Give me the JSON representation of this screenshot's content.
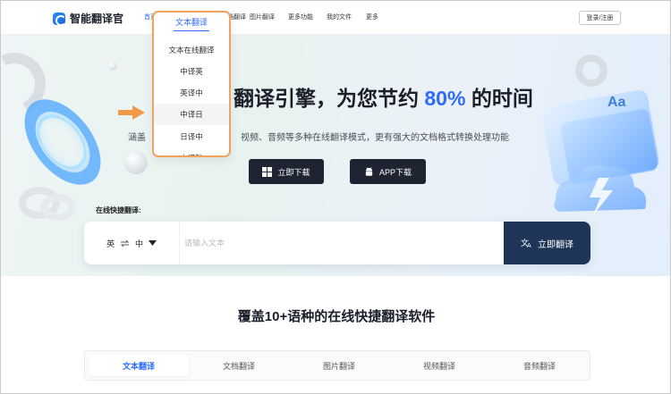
{
  "app": {
    "name": "智能翻译官"
  },
  "nav": {
    "items": [
      {
        "label": "首页",
        "active": true
      },
      {
        "label": "文档翻译",
        "active": false
      },
      {
        "label": "图片翻译",
        "active": false
      },
      {
        "label": "更多功能",
        "active": false
      },
      {
        "label": "我的文件",
        "active": false
      },
      {
        "label": "更多",
        "active": false
      }
    ],
    "login_label": "登录/注册"
  },
  "dropdown": {
    "header": "文本翻译",
    "items": [
      {
        "label": "文本在线翻译"
      },
      {
        "label": "中译英"
      },
      {
        "label": "英译中"
      },
      {
        "label": "中译日",
        "hovered": true
      },
      {
        "label": "日译中"
      },
      {
        "label": "中译韩"
      }
    ]
  },
  "hero": {
    "title_prefix": "翻译引擎，为您节约 ",
    "title_highlight": "80%",
    "title_suffix": " 的时间",
    "subtitle_prefix": "涵盖",
    "subtitle": "视频、音频等多种在线翻译模式，更有强大的文档格式转换处理功能",
    "download_label": "立即下载",
    "app_download_label": "APP下载"
  },
  "quick_translate": {
    "label": "在线快捷翻译:",
    "source_lang": "英",
    "swap_icon": "swap-arrows-icon",
    "target_lang": "中",
    "input_placeholder": "请输入文本",
    "input_value": "",
    "submit_label": "立即翻译"
  },
  "section": {
    "title": "覆盖10+语种的在线快捷翻译软件",
    "tabs": [
      {
        "label": "文本翻译",
        "active": true
      },
      {
        "label": "文档翻译",
        "active": false
      },
      {
        "label": "图片翻译",
        "active": false
      },
      {
        "label": "视频翻译",
        "active": false
      },
      {
        "label": "音频翻译",
        "active": false
      }
    ]
  },
  "colors": {
    "accent": "#2f6bff",
    "dark_button": "#1e2431",
    "translate_button": "#1f3558",
    "dropdown_border": "#f2a25c",
    "arrow": "#f29a4a"
  }
}
